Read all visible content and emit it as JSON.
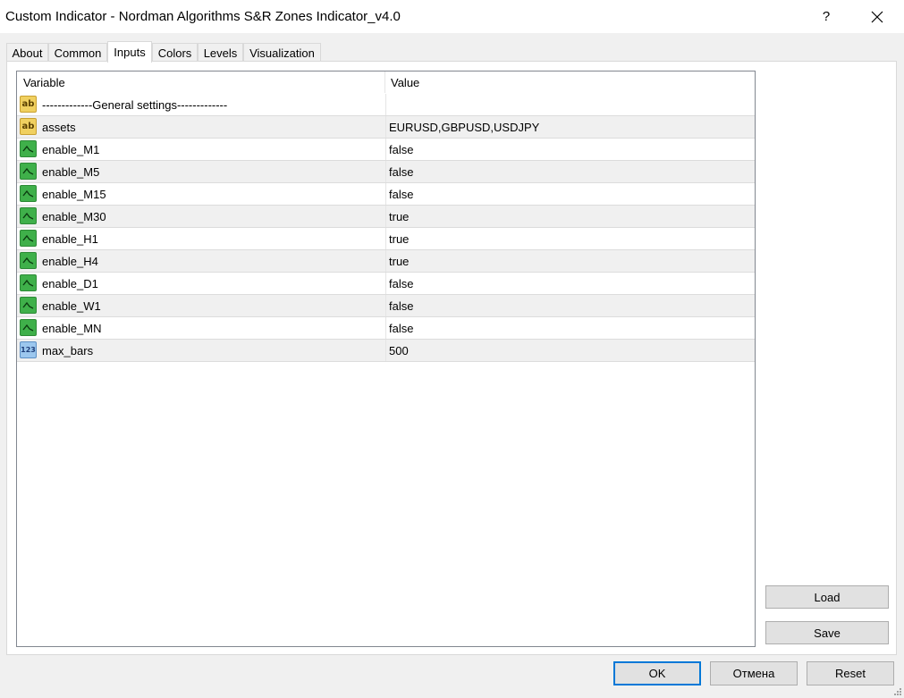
{
  "window": {
    "title": "Custom Indicator - Nordman Algorithms S&R Zones Indicator_v4.0",
    "help_label": "?"
  },
  "tabs": [
    {
      "label": "About"
    },
    {
      "label": "Common"
    },
    {
      "label": "Inputs",
      "active": true
    },
    {
      "label": "Colors"
    },
    {
      "label": "Levels"
    },
    {
      "label": "Visualization"
    }
  ],
  "grid": {
    "headers": {
      "variable": "Variable",
      "value": "Value"
    },
    "rows": [
      {
        "type": "string",
        "icon": "ab-string-icon",
        "variable": "-------------General settings-------------",
        "value": ""
      },
      {
        "type": "string",
        "icon": "ab-string-icon",
        "variable": "assets",
        "value": "EURUSD,GBPUSD,USDJPY"
      },
      {
        "type": "bool",
        "icon": "bool-icon",
        "variable": "enable_M1",
        "value": "false"
      },
      {
        "type": "bool",
        "icon": "bool-icon",
        "variable": "enable_M5",
        "value": "false"
      },
      {
        "type": "bool",
        "icon": "bool-icon",
        "variable": "enable_M15",
        "value": "false"
      },
      {
        "type": "bool",
        "icon": "bool-icon",
        "variable": "enable_M30",
        "value": "true"
      },
      {
        "type": "bool",
        "icon": "bool-icon",
        "variable": "enable_H1",
        "value": "true"
      },
      {
        "type": "bool",
        "icon": "bool-icon",
        "variable": "enable_H4",
        "value": "true"
      },
      {
        "type": "bool",
        "icon": "bool-icon",
        "variable": "enable_D1",
        "value": "false"
      },
      {
        "type": "bool",
        "icon": "bool-icon",
        "variable": "enable_W1",
        "value": "false"
      },
      {
        "type": "bool",
        "icon": "bool-icon",
        "variable": "enable_MN",
        "value": "false"
      },
      {
        "type": "int",
        "icon": "number-icon",
        "variable": "max_bars",
        "value": "500"
      }
    ]
  },
  "side_buttons": {
    "load_label": "Load",
    "save_label": "Save"
  },
  "dialog_buttons": {
    "ok_label": "OK",
    "cancel_label": "Отмена",
    "reset_label": "Reset"
  },
  "icon_text": {
    "ab": "ab",
    "num": "123"
  }
}
